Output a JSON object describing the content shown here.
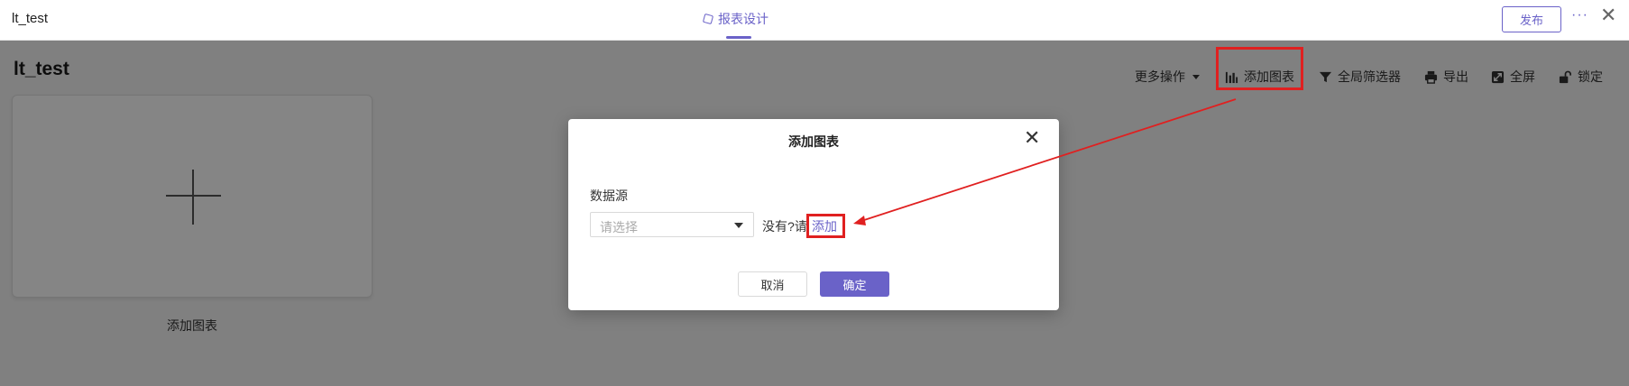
{
  "window": {
    "title": "lt_test"
  },
  "header": {
    "center_tab": "报表设计",
    "publish_label": "发布",
    "more_label": "···"
  },
  "page": {
    "title": "lt_test",
    "toolbar": {
      "more_ops": "更多操作",
      "add_chart": "添加图表",
      "global_filter": "全局筛选器",
      "export": "导出",
      "fullscreen": "全屏",
      "lock": "锁定"
    },
    "add_card_label": "添加图表"
  },
  "dialog": {
    "title": "添加图表",
    "datasource_label": "数据源",
    "select_placeholder": "请选择",
    "none_text": "没有?请",
    "add_link": "添加",
    "cancel_label": "取消",
    "ok_label": "确定"
  },
  "colors": {
    "accent": "#6a62c8",
    "annotation": "#e02020"
  }
}
